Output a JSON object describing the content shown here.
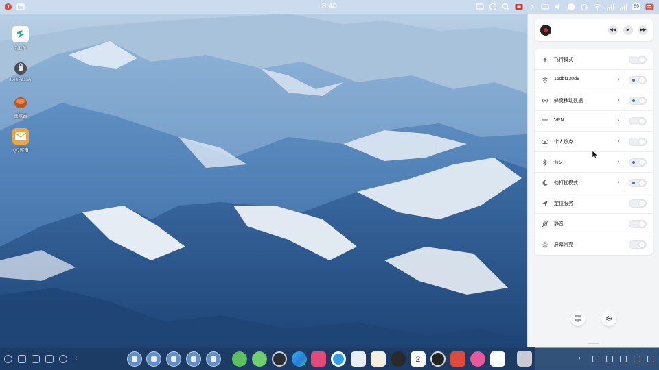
{
  "topbar": {
    "time": "8:40",
    "battery": "86"
  },
  "desktop": {
    "icons": [
      {
        "label": "Z工单",
        "icon": "ticket-app-icon"
      },
      {
        "label": "KeePassA",
        "icon": "keepass-icon"
      },
      {
        "label": "坚果云",
        "icon": "jianguoyun-icon"
      },
      {
        "label": "QQ邮箱",
        "icon": "qq-mail-icon"
      }
    ]
  },
  "control_panel": {
    "media": {
      "prev_icon": "◀◀",
      "play_icon": "▶",
      "next_icon": "▶▶"
    },
    "settings": [
      {
        "label": "飞行模式",
        "icon": "airplane-icon",
        "has_chevron": false,
        "toggle": "off"
      },
      {
        "label": "16dbf130d8",
        "icon": "wifi-icon",
        "has_chevron": true,
        "toggle": "on"
      },
      {
        "label": "蜂窝移动数据",
        "icon": "cellular-icon",
        "has_chevron": true,
        "toggle": "on"
      },
      {
        "label": "VPN",
        "icon": "vpn-icon",
        "has_chevron": true,
        "toggle": "off"
      },
      {
        "label": "个人热点",
        "icon": "hotspot-icon",
        "has_chevron": true,
        "toggle": "off"
      },
      {
        "label": "蓝牙",
        "icon": "bluetooth-icon",
        "has_chevron": true,
        "toggle": "on"
      },
      {
        "label": "勿打扰模式",
        "icon": "moon-icon",
        "has_chevron": true,
        "toggle": "on"
      },
      {
        "label": "定位服务",
        "icon": "location-icon",
        "has_chevron": false,
        "toggle": "off"
      },
      {
        "label": "静音",
        "icon": "mute-icon",
        "has_chevron": false,
        "toggle": "off"
      },
      {
        "label": "屏幕常亮",
        "icon": "brightness-icon",
        "has_chevron": false,
        "toggle": "off"
      }
    ],
    "chevron": "›"
  },
  "taskbar": {
    "overflow_chevron": "‹",
    "tray_chevron": "›",
    "calendar_day": "2"
  },
  "colors": {
    "accent": "#3b78e7",
    "panel_bg": "#f3f4f6",
    "taskbar_bg": "#1c3a62"
  }
}
